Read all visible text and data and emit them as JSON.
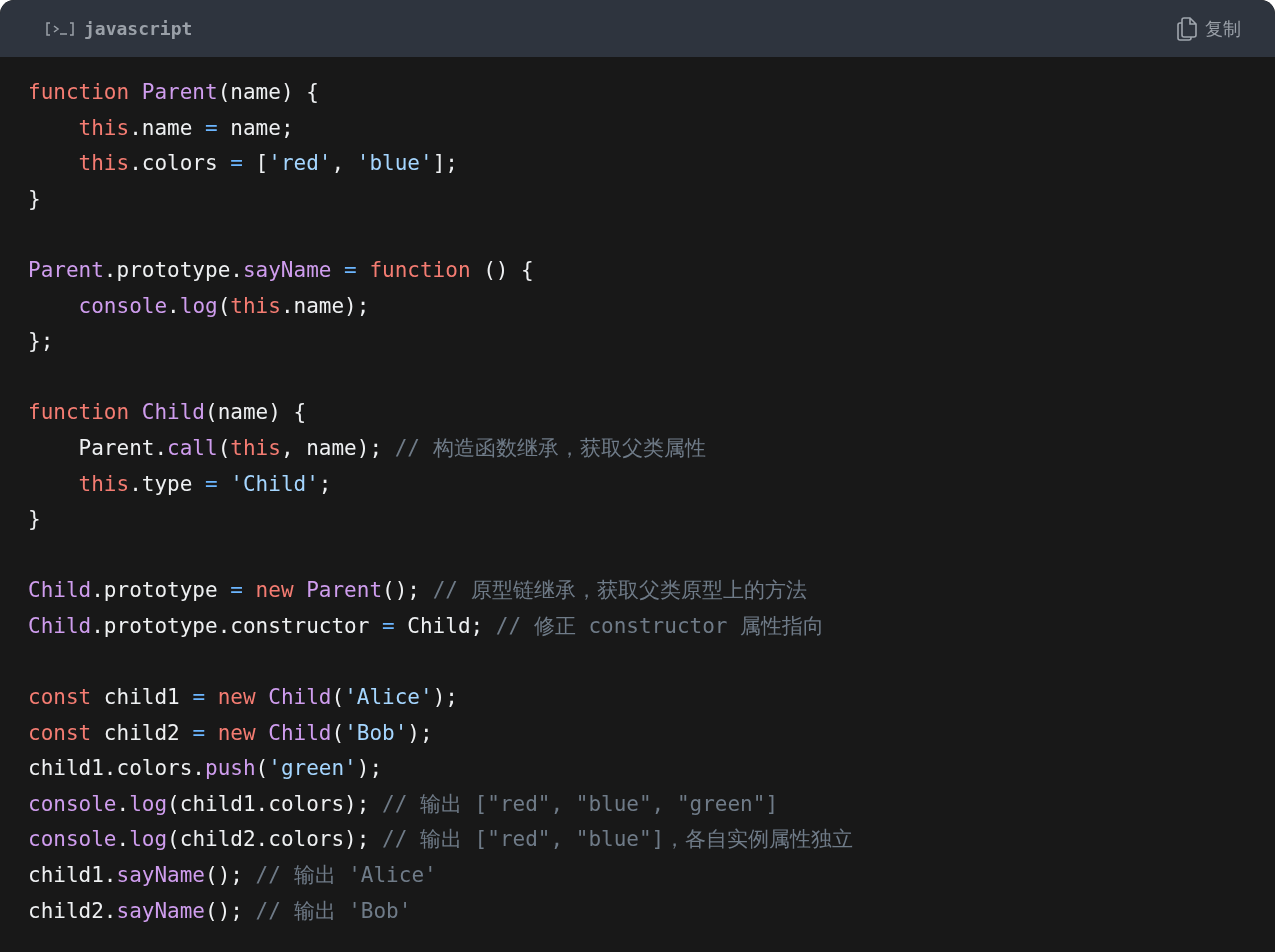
{
  "header": {
    "language": "javascript",
    "copy_label": "复制"
  },
  "lines": [
    {
      "kind": "code",
      "tokens": [
        {
          "kind": "keyword",
          "text": "function"
        },
        {
          "kind": "function",
          "text": " Parent"
        },
        {
          "kind": "plain",
          "text": "(name) {"
        }
      ]
    },
    {
      "kind": "code",
      "tokens": [
        {
          "kind": "keyword",
          "text": "    this"
        },
        {
          "kind": "plain",
          "text": ".name "
        },
        {
          "kind": "operator",
          "text": "="
        },
        {
          "kind": "plain",
          "text": " name;"
        }
      ]
    },
    {
      "kind": "code",
      "tokens": [
        {
          "kind": "keyword",
          "text": "    this"
        },
        {
          "kind": "plain",
          "text": ".colors "
        },
        {
          "kind": "operator",
          "text": "="
        },
        {
          "kind": "plain",
          "text": " ["
        },
        {
          "kind": "string",
          "text": "'red'"
        },
        {
          "kind": "plain",
          "text": ", "
        },
        {
          "kind": "string",
          "text": "'blue'"
        },
        {
          "kind": "plain",
          "text": "];"
        }
      ]
    },
    {
      "kind": "code",
      "tokens": [
        {
          "kind": "plain",
          "text": "}"
        }
      ]
    },
    {
      "kind": "blank"
    },
    {
      "kind": "code",
      "tokens": [
        {
          "kind": "function",
          "text": "Parent"
        },
        {
          "kind": "plain",
          "text": ".prototype."
        },
        {
          "kind": "function",
          "text": "sayName"
        },
        {
          "kind": "operator",
          "text": " ="
        },
        {
          "kind": "keyword",
          "text": " function"
        },
        {
          "kind": "plain",
          "text": " () {"
        }
      ]
    },
    {
      "kind": "code",
      "tokens": [
        {
          "kind": "function",
          "text": "    console"
        },
        {
          "kind": "plain",
          "text": "."
        },
        {
          "kind": "function",
          "text": "log"
        },
        {
          "kind": "plain",
          "text": "("
        },
        {
          "kind": "keyword",
          "text": "this"
        },
        {
          "kind": "plain",
          "text": ".name);"
        }
      ]
    },
    {
      "kind": "code",
      "tokens": [
        {
          "kind": "plain",
          "text": "};"
        }
      ]
    },
    {
      "kind": "blank"
    },
    {
      "kind": "code",
      "tokens": [
        {
          "kind": "keyword",
          "text": "function"
        },
        {
          "kind": "function",
          "text": " Child"
        },
        {
          "kind": "plain",
          "text": "(name) {"
        }
      ]
    },
    {
      "kind": "code",
      "tokens": [
        {
          "kind": "plain",
          "text": "    Parent."
        },
        {
          "kind": "function",
          "text": "call"
        },
        {
          "kind": "plain",
          "text": "("
        },
        {
          "kind": "keyword",
          "text": "this"
        },
        {
          "kind": "plain",
          "text": ", name); "
        },
        {
          "kind": "comment",
          "text": "// 构造函数继承，获取父类属性"
        }
      ]
    },
    {
      "kind": "code",
      "tokens": [
        {
          "kind": "keyword",
          "text": "    this"
        },
        {
          "kind": "plain",
          "text": ".type "
        },
        {
          "kind": "operator",
          "text": "="
        },
        {
          "kind": "string",
          "text": " 'Child'"
        },
        {
          "kind": "plain",
          "text": ";"
        }
      ]
    },
    {
      "kind": "code",
      "tokens": [
        {
          "kind": "plain",
          "text": "}"
        }
      ]
    },
    {
      "kind": "blank"
    },
    {
      "kind": "code",
      "tokens": [
        {
          "kind": "function",
          "text": "Child"
        },
        {
          "kind": "plain",
          "text": ".prototype "
        },
        {
          "kind": "operator",
          "text": "="
        },
        {
          "kind": "keyword",
          "text": " new"
        },
        {
          "kind": "function",
          "text": " Parent"
        },
        {
          "kind": "plain",
          "text": "(); "
        },
        {
          "kind": "comment",
          "text": "// 原型链继承，获取父类原型上的方法"
        }
      ]
    },
    {
      "kind": "code",
      "tokens": [
        {
          "kind": "function",
          "text": "Child"
        },
        {
          "kind": "plain",
          "text": ".prototype.constructor "
        },
        {
          "kind": "operator",
          "text": "="
        },
        {
          "kind": "plain",
          "text": " Child; "
        },
        {
          "kind": "comment",
          "text": "// 修正 constructor 属性指向"
        }
      ]
    },
    {
      "kind": "blank"
    },
    {
      "kind": "code",
      "tokens": [
        {
          "kind": "keyword",
          "text": "const"
        },
        {
          "kind": "plain",
          "text": " child1 "
        },
        {
          "kind": "operator",
          "text": "="
        },
        {
          "kind": "keyword",
          "text": " new"
        },
        {
          "kind": "function",
          "text": " Child"
        },
        {
          "kind": "plain",
          "text": "("
        },
        {
          "kind": "string",
          "text": "'Alice'"
        },
        {
          "kind": "plain",
          "text": ");"
        }
      ]
    },
    {
      "kind": "code",
      "tokens": [
        {
          "kind": "keyword",
          "text": "const"
        },
        {
          "kind": "plain",
          "text": " child2 "
        },
        {
          "kind": "operator",
          "text": "="
        },
        {
          "kind": "keyword",
          "text": " new"
        },
        {
          "kind": "function",
          "text": " Child"
        },
        {
          "kind": "plain",
          "text": "("
        },
        {
          "kind": "string",
          "text": "'Bob'"
        },
        {
          "kind": "plain",
          "text": ");"
        }
      ]
    },
    {
      "kind": "code",
      "tokens": [
        {
          "kind": "plain",
          "text": "child1.colors."
        },
        {
          "kind": "function",
          "text": "push"
        },
        {
          "kind": "plain",
          "text": "("
        },
        {
          "kind": "string",
          "text": "'green'"
        },
        {
          "kind": "plain",
          "text": ");"
        }
      ]
    },
    {
      "kind": "code",
      "tokens": [
        {
          "kind": "function",
          "text": "console"
        },
        {
          "kind": "plain",
          "text": "."
        },
        {
          "kind": "function",
          "text": "log"
        },
        {
          "kind": "plain",
          "text": "(child1.colors); "
        },
        {
          "kind": "comment",
          "text": "// 输出 [\"red\", \"blue\", \"green\"]"
        }
      ]
    },
    {
      "kind": "code",
      "tokens": [
        {
          "kind": "function",
          "text": "console"
        },
        {
          "kind": "plain",
          "text": "."
        },
        {
          "kind": "function",
          "text": "log"
        },
        {
          "kind": "plain",
          "text": "(child2.colors); "
        },
        {
          "kind": "comment",
          "text": "// 输出 [\"red\", \"blue\"]，各自实例属性独立"
        }
      ]
    },
    {
      "kind": "code",
      "tokens": [
        {
          "kind": "plain",
          "text": "child1."
        },
        {
          "kind": "function",
          "text": "sayName"
        },
        {
          "kind": "plain",
          "text": "(); "
        },
        {
          "kind": "comment",
          "text": "// 输出 'Alice'"
        }
      ]
    },
    {
      "kind": "code",
      "tokens": [
        {
          "kind": "plain",
          "text": "child2."
        },
        {
          "kind": "function",
          "text": "sayName"
        },
        {
          "kind": "plain",
          "text": "(); "
        },
        {
          "kind": "comment",
          "text": "// 输出 'Bob'"
        }
      ]
    }
  ]
}
